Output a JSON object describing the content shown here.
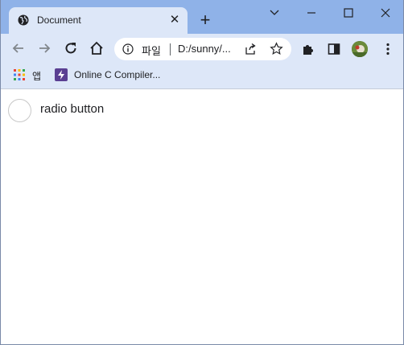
{
  "tab": {
    "title": "Document",
    "close_glyph": "✕",
    "icon": "globe-icon"
  },
  "new_tab_glyph": "+",
  "window_controls": {
    "minimize": "minimize-icon",
    "maximize": "maximize-icon",
    "close": "close-icon",
    "dropdown": "chevron-down-icon"
  },
  "toolbar": {
    "back": "back-arrow-icon",
    "forward": "forward-arrow-icon",
    "reload": "reload-icon",
    "home": "home-icon",
    "omnibox": {
      "scheme_label": "파일",
      "url": "D:/sunny/..."
    },
    "extensions": "puzzle-icon",
    "side_panel": "side-panel-icon",
    "menu": "kebab-menu-icon"
  },
  "bookmarks": [
    {
      "label": "앱",
      "icon": "apps-grid-icon"
    },
    {
      "label": "Online C Compiler...",
      "icon": "bolt-icon"
    }
  ],
  "page": {
    "radio_label": "radio button",
    "radio_checked": false
  },
  "colors": {
    "frame": "#8fb2e8",
    "toolbar": "#dde7f8",
    "text": "#202124",
    "radio_border": "#c8c8c8"
  }
}
